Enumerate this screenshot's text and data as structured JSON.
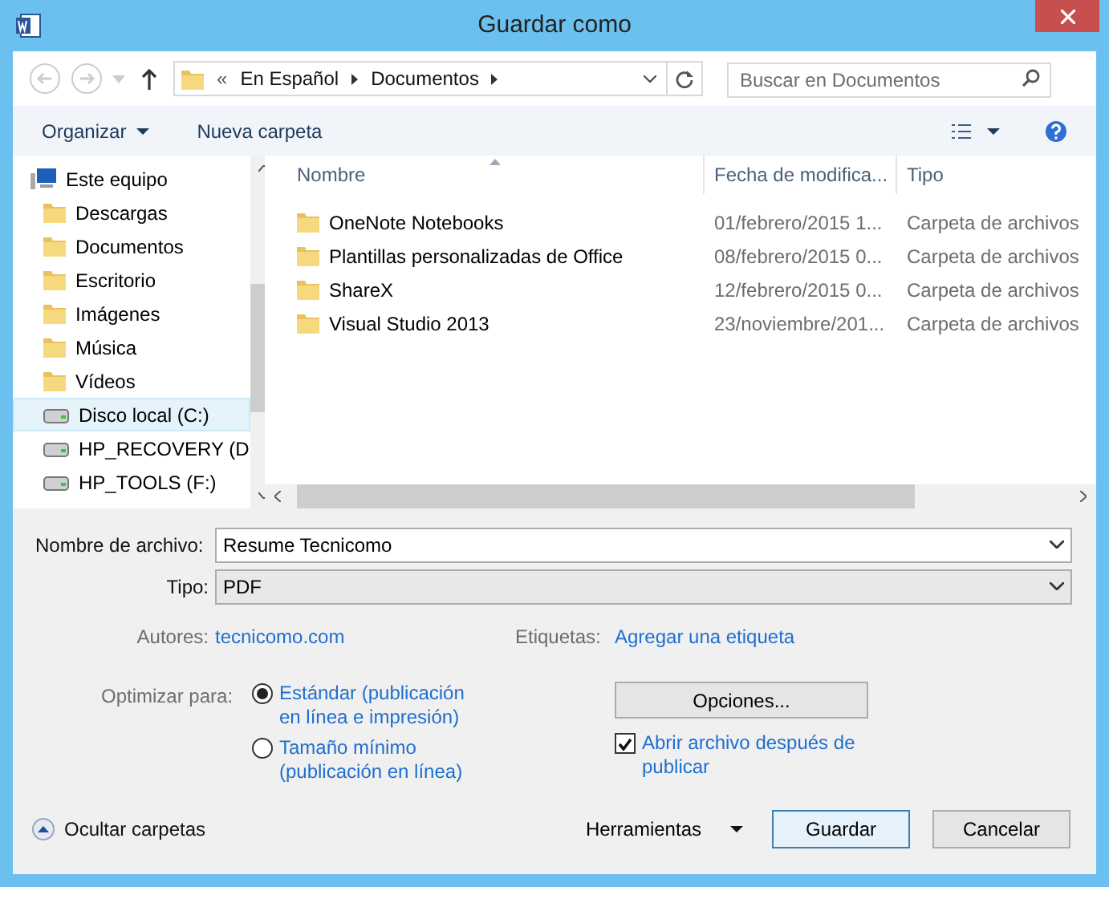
{
  "window": {
    "title": "Guardar como"
  },
  "address": {
    "prefix": "«",
    "crumbs": [
      "En Español",
      "Documentos"
    ]
  },
  "search": {
    "placeholder": "Buscar en Documentos"
  },
  "toolbar": {
    "organize": "Organizar",
    "new_folder": "Nueva carpeta"
  },
  "sidebar": {
    "items": [
      {
        "label": "Este equipo",
        "kind": "computer",
        "selected": false,
        "children": [
          {
            "label": "Descargas",
            "kind": "folder",
            "selected": false
          },
          {
            "label": "Documentos",
            "kind": "folder",
            "selected": false
          },
          {
            "label": "Escritorio",
            "kind": "folder",
            "selected": false
          },
          {
            "label": "Imágenes",
            "kind": "folder",
            "selected": false
          },
          {
            "label": "Música",
            "kind": "folder",
            "selected": false
          },
          {
            "label": "Vídeos",
            "kind": "folder",
            "selected": false
          },
          {
            "label": "Disco local (C:)",
            "kind": "drive",
            "selected": true
          },
          {
            "label": "HP_RECOVERY (D",
            "kind": "drive",
            "selected": false
          },
          {
            "label": "HP_TOOLS (F:)",
            "kind": "drive",
            "selected": false
          }
        ]
      }
    ]
  },
  "table": {
    "columns": [
      "Nombre",
      "Fecha de modifica...",
      "Tipo"
    ],
    "rows": [
      [
        "OneNote Notebooks",
        "01/febrero/2015 1...",
        "Carpeta de archivos"
      ],
      [
        "Plantillas personalizadas de Office",
        "08/febrero/2015 0...",
        "Carpeta de archivos"
      ],
      [
        "ShareX",
        "12/febrero/2015 0...",
        "Carpeta de archivos"
      ],
      [
        "Visual Studio 2013",
        "23/noviembre/201...",
        "Carpeta de archivos"
      ]
    ]
  },
  "form": {
    "filename_label": "Nombre de archivo:",
    "filename": "Resume Tecnicomo",
    "type_label": "Tipo:",
    "type": "PDF",
    "authors_label": "Autores:",
    "authors": "tecnicomo.com",
    "tags_label": "Etiquetas:",
    "tags": "Agregar una etiqueta",
    "optimize_label": "Optimizar para:",
    "options": [
      {
        "label": "Estándar (publicación en línea e impresión)",
        "selected": true
      },
      {
        "label": "Tamaño mínimo (publicación en línea)",
        "selected": false
      }
    ],
    "options_button": "Opciones...",
    "open_after": {
      "label": "Abrir archivo después de publicar",
      "checked": true
    }
  },
  "footer": {
    "hide_folders": "Ocultar carpetas",
    "tools": "Herramientas",
    "save": "Guardar",
    "cancel": "Cancelar"
  }
}
